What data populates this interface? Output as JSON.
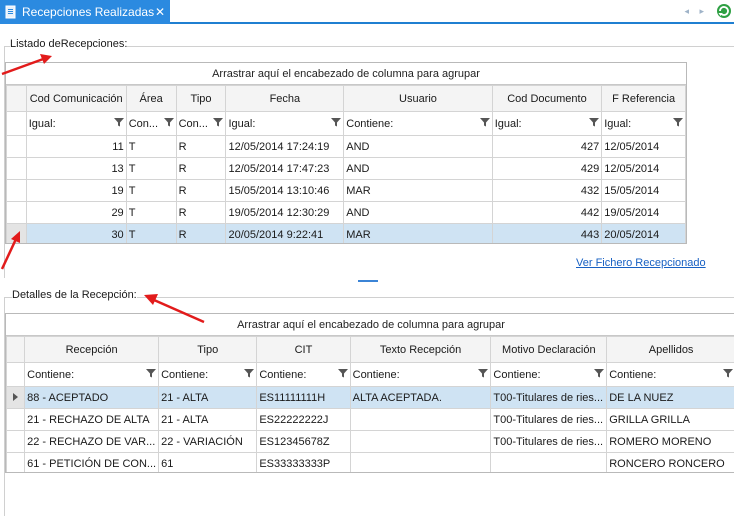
{
  "window": {
    "tab_title": "Recepciones Realizadas",
    "close_glyph": "✕",
    "nav_glyphs": "◂ ▸"
  },
  "upper": {
    "label": "Listado deRecepciones:",
    "drop_hint": "Arrastrar aquí el encabezado de columna para agrupar",
    "columns": [
      "Cod Comunicación",
      "Área",
      "Tipo",
      "Fecha",
      "Usuario",
      "Cod Documento",
      "F Referencia"
    ],
    "filters": [
      "Igual:",
      "Con...",
      "Con...",
      "Igual:",
      "Contiene:",
      "Igual:",
      "Igual:"
    ],
    "rows": [
      [
        "11",
        "T",
        "R",
        "12/05/2014 17:24:19",
        "AND",
        "427",
        "12/05/2014"
      ],
      [
        "13",
        "T",
        "R",
        "12/05/2014 17:47:23",
        "AND",
        "429",
        "12/05/2014"
      ],
      [
        "19",
        "T",
        "R",
        "15/05/2014 13:10:46",
        "MAR",
        "432",
        "15/05/2014"
      ],
      [
        "29",
        "T",
        "R",
        "19/05/2014 12:30:29",
        "AND",
        "442",
        "19/05/2014"
      ],
      [
        "30",
        "T",
        "R",
        "20/05/2014 9:22:41",
        "MAR",
        "443",
        "20/05/2014"
      ]
    ],
    "selected_row": 4,
    "link": "Ver Fichero Recepcionado"
  },
  "lower": {
    "label": "Detalles de la Recepción:",
    "drop_hint": "Arrastrar aquí el encabezado de columna para agrupar",
    "columns": [
      "Recepción",
      "Tipo",
      "CIT",
      "Texto Recepción",
      "Motivo Declaración",
      "Apellidos"
    ],
    "filters": [
      "Contiene:",
      "Contiene:",
      "Contiene:",
      "Contiene:",
      "Contiene:",
      "Contiene:"
    ],
    "rows": [
      [
        "88 - ACEPTADO",
        "21 - ALTA",
        "ES11111111H",
        "ALTA ACEPTADA.",
        "T00-Titulares de ries...",
        "DE LA NUEZ"
      ],
      [
        "21 - RECHAZO DE ALTA",
        "21 - ALTA",
        "ES22222222J",
        "",
        "T00-Titulares de ries...",
        "GRILLA GRILLA"
      ],
      [
        "22 - RECHAZO DE VAR...",
        "22 - VARIACIÓN",
        "ES12345678Z",
        "",
        "T00-Titulares de ries...",
        "ROMERO MORENO"
      ],
      [
        "61 - PETICIÓN DE CON...",
        "61",
        "ES33333333P",
        "",
        "",
        "RONCERO RONCERO"
      ]
    ],
    "selected_row": 0
  },
  "colors": {
    "tab_bg": "#2b8ae0",
    "selection": "#cfe3f3",
    "link": "#1760c3",
    "annotation_arrow": "#e21b1b"
  }
}
